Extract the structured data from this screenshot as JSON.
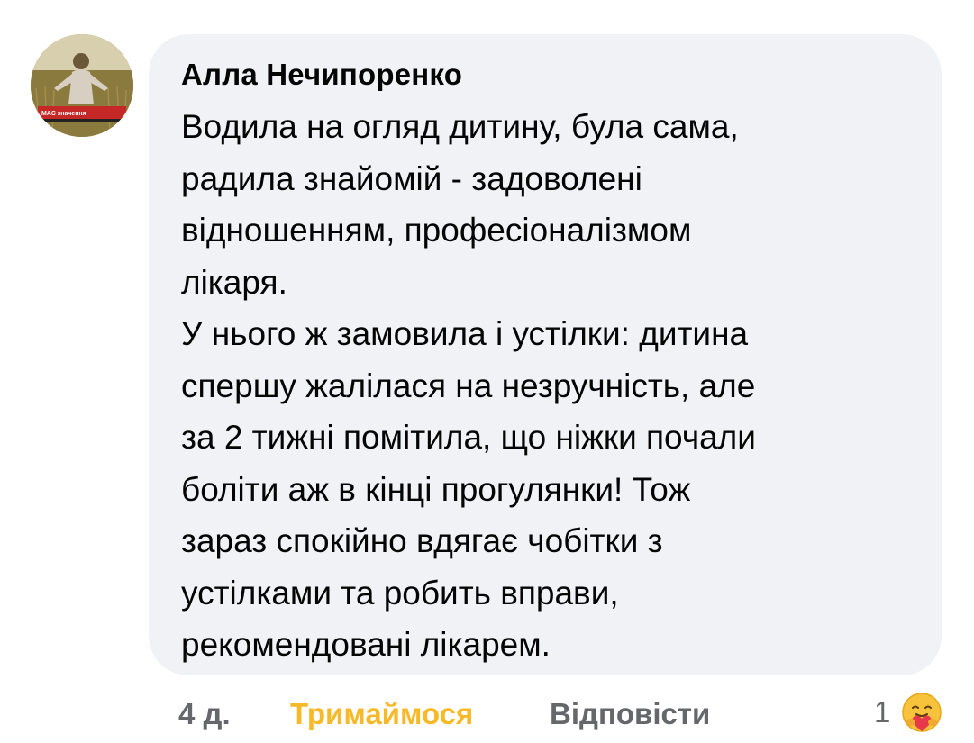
{
  "comment": {
    "author": "Алла Нечипоренко",
    "text": "Водила на огляд дитину, була сама,\nрадила знайомій - задоволені\nвідношенням, професіоналізмом\nлікаря.\nУ нього ж замовила і устілки: дитина\nспершу жалілася на незручність, але\nза 2 тижні помітила, що ніжки почали\nболіти аж   в кінці прогулянки! Тож\nзараз спокійно вдягає чобітки з\nустілками та робить вправи,\nрекомендовані лікарем.",
    "avatar_label": "МАЄ значення",
    "avatar_icon": "profile-photo"
  },
  "footer": {
    "time": "4 д.",
    "reaction_label": "Тримаймося",
    "reply_label": "Відповісти",
    "reaction_count": "1",
    "reaction_icon": "care-emoji-icon"
  },
  "colors": {
    "bubble": "#f0f2f5",
    "text": "#050505",
    "meta": "#65676b",
    "care_reaction": "#f7b928"
  }
}
